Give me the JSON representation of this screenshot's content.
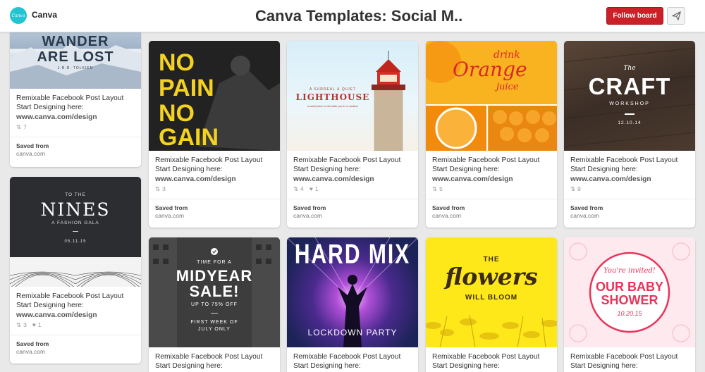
{
  "header": {
    "logo_text": "Canva",
    "brand": "Canva",
    "title": "Canva Templates: Social M..",
    "follow_label": "Follow board"
  },
  "pin_common": {
    "desc_line1": "Remixable Facebook Post Layout",
    "desc_line2": "Start Designing here:",
    "desc_link": "www.canva.com/design",
    "saved_from": "Saved from",
    "source": "canva.com"
  },
  "pins": [
    {
      "art": {
        "line1": "WANDER",
        "line2": "ARE LOST",
        "credit": "J.R.R. TOLKIEN"
      },
      "repins": "7",
      "likes": null
    },
    {
      "art": {
        "line1": "NO",
        "line2": "PAIN",
        "line3": "NO",
        "line4": "GAIN"
      },
      "repins": "3",
      "likes": null
    },
    {
      "art": {
        "kicker": "A SURREAL & QUIET",
        "headline": "LIGHTHOUSE",
        "tag": "a sweet place to visit while you're on vacation"
      },
      "repins": "4",
      "likes": "1"
    },
    {
      "art": {
        "line1": "drink",
        "line2": "Orange",
        "line3": "juice"
      },
      "repins": "5",
      "likes": null
    },
    {
      "art": {
        "kicker": "The",
        "headline": "CRAFT",
        "sub": "WORKSHOP",
        "date": "12.10.14"
      },
      "repins": "9",
      "likes": null
    },
    {
      "art": {
        "kicker": "TO THE",
        "headline": "NINES",
        "sub": "A FASHION GALA",
        "date": "05.11.15"
      },
      "repins": "3",
      "likes": "1"
    },
    {
      "art": {
        "kicker": "TIME FOR A",
        "line1": "MIDYEAR",
        "line2": "SALE!",
        "sub": "UP TO 75% OFF",
        "foot1": "FIRST WEEK OF",
        "foot2": "JULY ONLY"
      }
    },
    {
      "art": {
        "headline": "HARD MIX",
        "sub": "LOCKDOWN PARTY"
      }
    },
    {
      "art": {
        "kicker": "THE",
        "headline": "flowers",
        "sub": "WILL BLOOM"
      }
    },
    {
      "art": {
        "kicker": "You're invited!",
        "line1": "OUR BABY",
        "line2": "SHOWER",
        "date": "10.20.15"
      }
    }
  ]
}
